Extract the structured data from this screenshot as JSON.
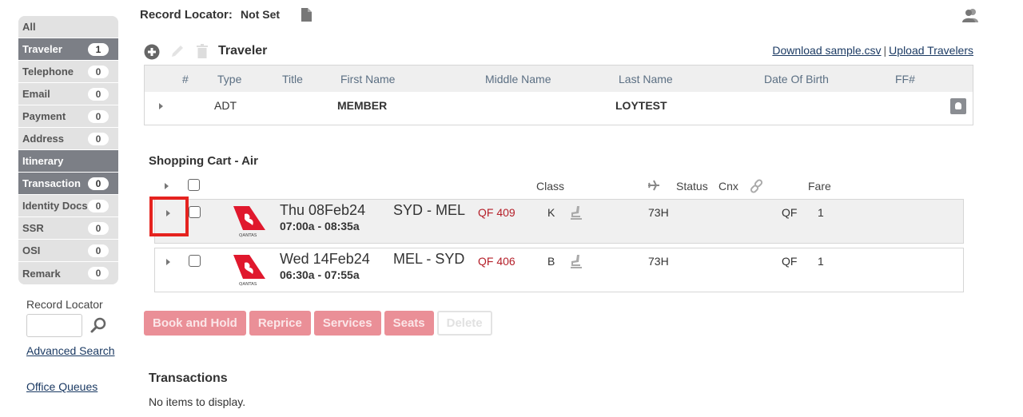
{
  "sidebar": {
    "items": [
      {
        "label": "All",
        "count": null,
        "style": "light"
      },
      {
        "label": "Traveler",
        "count": "1",
        "style": "dark"
      },
      {
        "label": "Telephone",
        "count": "0",
        "style": "light"
      },
      {
        "label": "Email",
        "count": "0",
        "style": "light"
      },
      {
        "label": "Payment",
        "count": "0",
        "style": "light"
      },
      {
        "label": "Address",
        "count": "0",
        "style": "light"
      },
      {
        "label": "Itinerary",
        "count": null,
        "style": "dark"
      },
      {
        "label": "Transaction",
        "count": "0",
        "style": "dark"
      },
      {
        "label": "Identity Docs",
        "count": "0",
        "style": "light"
      },
      {
        "label": "SSR",
        "count": "0",
        "style": "light"
      },
      {
        "label": "OSI",
        "count": "0",
        "style": "light"
      },
      {
        "label": "Remark",
        "count": "0",
        "style": "light"
      }
    ],
    "record_locator_label": "Record Locator",
    "record_locator_value": "",
    "advanced_search": "Advanced Search",
    "office_queues": "Office Queues"
  },
  "header": {
    "record_locator_label": "Record Locator:",
    "record_locator_value": "Not Set"
  },
  "traveler": {
    "heading": "Traveler",
    "download_link": "Download sample.csv",
    "separator": "|",
    "upload_link": "Upload Travelers",
    "columns": [
      "#",
      "Type",
      "Title",
      "First Name",
      "Middle Name",
      "Last Name",
      "Date Of Birth",
      "FF#"
    ],
    "rows": [
      {
        "num": "",
        "type": "ADT",
        "title": "",
        "first_name": "MEMBER",
        "middle_name": "",
        "last_name": "LOYTEST",
        "dob": "",
        "ff": ""
      }
    ]
  },
  "cart": {
    "title": "Shopping Cart - Air",
    "columns": {
      "class": "Class",
      "status": "Status",
      "cnx": "Cnx",
      "fare": "Fare"
    },
    "segments": [
      {
        "date": "Thu 08Feb24",
        "time": "07:00a - 08:35a",
        "route": "SYD - MEL",
        "flight": "QF 409",
        "class": "K",
        "equipment": "73H",
        "carrier": "QF",
        "fare": "1",
        "airline": "QANTAS"
      },
      {
        "date": "Wed 14Feb24",
        "time": "06:30a - 07:55a",
        "route": "MEL - SYD",
        "flight": "QF 406",
        "class": "B",
        "equipment": "73H",
        "carrier": "QF",
        "fare": "1",
        "airline": "QANTAS"
      }
    ]
  },
  "actions": {
    "book_and_hold": "Book and Hold",
    "reprice": "Reprice",
    "services": "Services",
    "seats": "Seats",
    "delete": "Delete"
  },
  "transactions": {
    "title": "Transactions",
    "empty": "No items to display."
  },
  "colors": {
    "accent_red": "#b5202a",
    "button_pink": "#ea8f97",
    "sidebar_dark": "#7c7f86",
    "highlight": "#e5231f"
  }
}
